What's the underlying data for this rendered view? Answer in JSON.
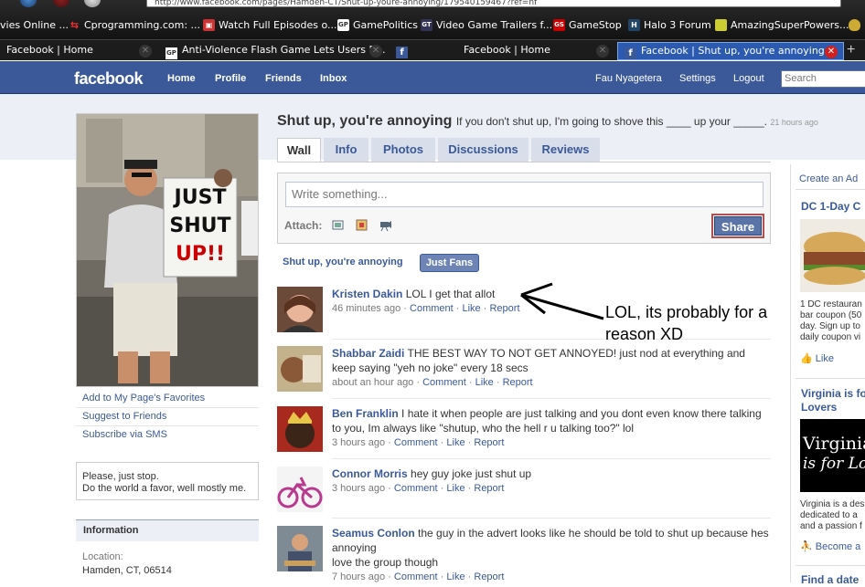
{
  "browser": {
    "url": "http://www.facebook.com/pages/Hamden-CT/Shut-up-youre-annoying/179540159467?ref=nf",
    "bookmarks": [
      {
        "label": "vies Online ..."
      },
      {
        "label": "Cprogramming.com: ..."
      },
      {
        "label": "Watch Full Episodes o..."
      },
      {
        "label": "GamePolitics"
      },
      {
        "label": "Video Game Trailers f..."
      },
      {
        "label": "GameStop"
      },
      {
        "label": "Halo 3 Forum"
      },
      {
        "label": "AmazingSuperPowers..."
      }
    ],
    "tabs": [
      {
        "label": "Facebook | Home"
      },
      {
        "label": "Anti-Violence Flash Game Lets Users B..."
      },
      {
        "label": "Facebook | Home"
      },
      {
        "label": "Facebook | Shut up, you're annoying"
      }
    ],
    "new_tab": "+"
  },
  "fb": {
    "logo": "facebook",
    "nav": {
      "home": "Home",
      "profile": "Profile",
      "friends": "Friends",
      "inbox": "Inbox"
    },
    "user": {
      "name": "Fau Nyagetera",
      "settings": "Settings",
      "logout": "Logout"
    },
    "search_placeholder": "Search"
  },
  "page": {
    "title": "Shut up, you're annoying",
    "status": "If you don't shut up, I'm going to shove this ____ up your _____.",
    "status_time": "21 hours ago",
    "photo_sign": [
      "JUST",
      "SHUT",
      "UP!!"
    ],
    "tabs": [
      "Wall",
      "Info",
      "Photos",
      "Discussions",
      "Reviews"
    ],
    "left_links": [
      "Add to My Page's Favorites",
      "Suggest to Friends",
      "Subscribe via SMS"
    ],
    "about": [
      "Please, just stop.",
      "Do the world a favor, well mostly me."
    ],
    "info_header": "Information",
    "location_label": "Location:",
    "location_value": "Hamden, CT, 06514"
  },
  "publisher": {
    "placeholder": "Write something...",
    "attach_label": "Attach:",
    "share": "Share"
  },
  "filters": {
    "page": "Shut up, you're annoying",
    "fans": "Just Fans"
  },
  "stories": [
    {
      "name": "Kristen Dakin",
      "text": "LOL I get that allot",
      "time": "46 minutes ago"
    },
    {
      "name": "Shabbar Zaidi",
      "text": "THE BEST WAY TO NOT GET ANNOYED! just nod at everything and keep saying \"yeh no joke\" every 18 secs",
      "time": "about an hour ago"
    },
    {
      "name": "Ben Franklin",
      "text": "I hate it when people are just talking and you dont even know there talking to you, Im always like \"shutup, who the hell r u talking too?\" lol",
      "time": "3 hours ago"
    },
    {
      "name": "Connor Morris",
      "text": "hey guy joke just shut up",
      "time": "3 hours ago"
    },
    {
      "name": "Seamus Conlon",
      "text": "the guy in the advert looks like he should be told to shut up because hes annoying",
      "text2": "love the group though",
      "time": "7 hours ago"
    }
  ],
  "actions": {
    "comment": "Comment",
    "like": "Like",
    "report": "Report",
    "sep": "·"
  },
  "annotation": {
    "line1": "LOL, its probably for a",
    "line2": "reason XD"
  },
  "ads": {
    "create": "Create an Ad",
    "ad1_title": "DC 1-Day C",
    "ad1_text": [
      "1 DC restauran",
      "bar coupon (50",
      "day. Sign up to",
      "daily coupon vi"
    ],
    "like": "Like",
    "ad2_title": [
      "Virginia is fo",
      "Lovers"
    ],
    "ad2_img": [
      "Virginia",
      "is for Lov"
    ],
    "ad2_text": [
      "Virginia is a des",
      "dedicated to a",
      "and a passion f"
    ],
    "become": "Become a",
    "ad3_title": "Find a date"
  }
}
